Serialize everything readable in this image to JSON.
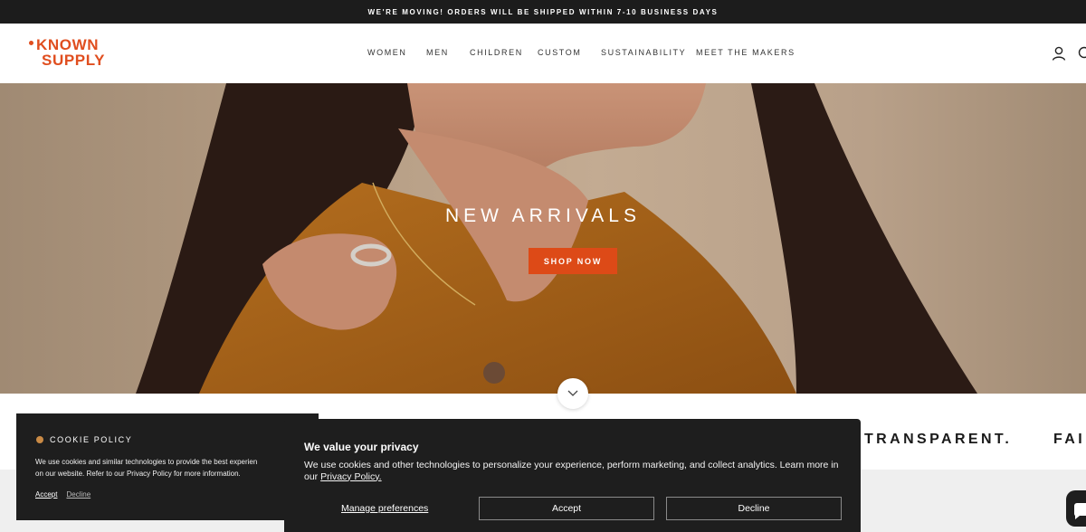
{
  "announcement": {
    "text": "WE'RE MOVING! ORDERS WILL BE SHIPPED WITHIN 7-10 BUSINESS DAYS"
  },
  "header": {
    "logo": {
      "line1": "KNOWN",
      "line2": "SUPPLY",
      "color": "#e04e1f"
    },
    "nav": [
      "WOMEN",
      "MEN",
      "CHILDREN",
      "CUSTOM",
      "SUSTAINABILITY",
      "MEET THE MAKERS"
    ],
    "icons": [
      "account-icon",
      "search-icon"
    ]
  },
  "hero": {
    "title": "NEW ARRIVALS",
    "cta": "SHOP NOW",
    "accent": "#dd4a17"
  },
  "marquee": {
    "words": [
      "TRANSPARENT.",
      "FAI"
    ]
  },
  "cookie_policy": {
    "title": "COOKIE POLICY",
    "line1": "We use cookies and similar technologies to provide the best experien",
    "line2": "on our website. Refer to our Privacy Policy for more information.",
    "accept": "Accept",
    "decline": "Decline"
  },
  "privacy_dialog": {
    "title": "We value your privacy",
    "body": "We use cookies and other technologies to personalize your experience, perform marketing, and collect analytics. Learn more in our",
    "link": "Privacy Policy.",
    "manage": "Manage preferences",
    "accept": "Accept",
    "decline": "Decline"
  }
}
